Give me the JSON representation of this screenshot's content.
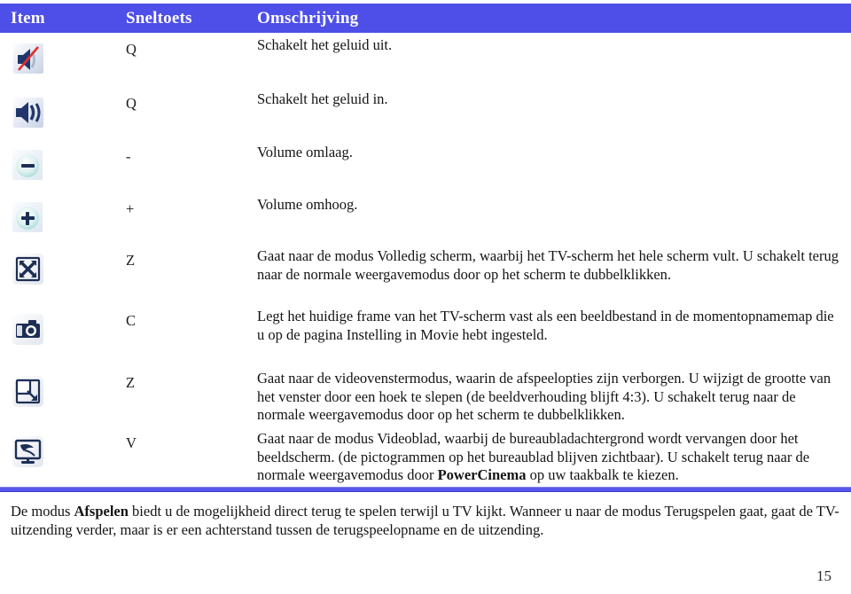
{
  "header": {
    "col_item": "Item",
    "col_shortcut": "Sneltoets",
    "col_description": "Omschrijving",
    "bar_color": "#4e4ee8"
  },
  "rows": [
    {
      "icon": "mute-icon",
      "shortcut": "Q",
      "description": "Schakelt het geluid uit."
    },
    {
      "icon": "unmute-speaker-icon",
      "shortcut": "Q",
      "description": "Schakelt het geluid in."
    },
    {
      "icon": "volume-down-icon",
      "shortcut": "-",
      "description": "Volume omlaag."
    },
    {
      "icon": "volume-up-icon",
      "shortcut": "+",
      "description": "Volume omhoog."
    },
    {
      "icon": "fullscreen-icon",
      "shortcut": "Z",
      "description": "Gaat naar de modus Volledig scherm, waarbij het TV-scherm het hele scherm vult. U schakelt terug naar de normale weergavemodus door op het scherm te dubbelklikken."
    },
    {
      "icon": "snapshot-camera-icon",
      "shortcut": "C",
      "description": "Legt het huidige frame van het TV-scherm vast als een beeldbestand in de momentopnamemap die u op de pagina Instelling in Movie hebt ingesteld."
    },
    {
      "icon": "video-window-resize-icon",
      "shortcut": "Z",
      "description": "Gaat naar de videovenstermodus, waarin de afspeelopties zijn verborgen. U wijzigt de grootte van het venster door een hoek te slepen (de beeldverhouding blijft 4:3). U schakelt terug naar de normale weergavemodus door op het scherm te dubbelklikken."
    },
    {
      "icon": "video-desktop-icon",
      "shortcut": "V",
      "description_part1": "Gaat naar de modus Videoblad, waarbij de bureaubladachtergrond wordt vervangen door het beeldscherm. (de pictogrammen op het bureaublad blijven zichtbaar). U schakelt terug naar de normale weergavemodus door ",
      "description_bold": "PowerCinema",
      "description_part2": " op uw taakbalk te kiezen."
    }
  ],
  "footer": {
    "part1": "De modus ",
    "bold1": "Afspelen",
    "part2": " biedt u de mogelijkheid direct terug te spelen terwijl u TV kijkt. Wanneer u naar de modus Terugspelen gaat, gaat de TV-uitzending verder, maar is er een achterstand tussen de terugspeelopname en de uitzending.",
    "page_number": "15"
  }
}
